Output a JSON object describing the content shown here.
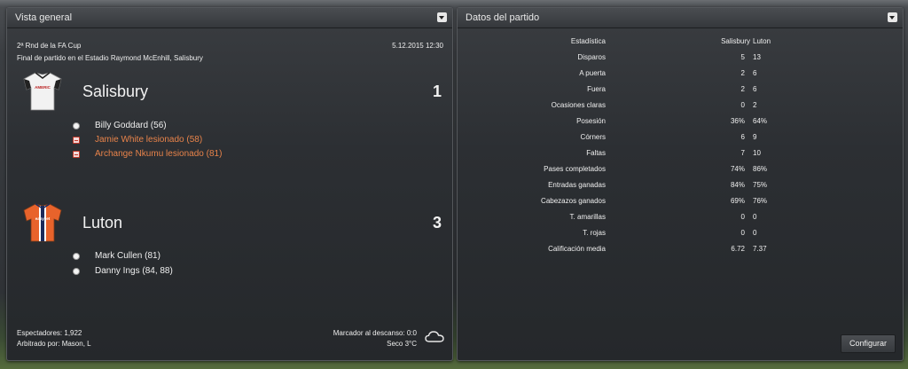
{
  "overview": {
    "title": "Vista general",
    "competition": "2ª Rnd de la FA Cup",
    "datetime": "5.12.2015 12:30",
    "venue": "Final de partido en el Estadio Raymond McEnhill, Salisbury",
    "home": {
      "name": "Salisbury",
      "score": "1",
      "shirt_text": "AMERIC",
      "events": [
        {
          "text": "Billy Goddard (56)",
          "type": "goal"
        },
        {
          "text": "Jamie White lesionado (58)",
          "type": "injury"
        },
        {
          "text": "Archange Nkumu lesionado (81)",
          "type": "injury"
        }
      ]
    },
    "away": {
      "name": "Luton",
      "score": "3",
      "shirt_text": "easyJet",
      "events": [
        {
          "text": "Mark Cullen (81)",
          "type": "goal"
        },
        {
          "text": "Danny Ings (84, 88)",
          "type": "goal"
        }
      ]
    },
    "attendance": "Espectadores: 1,922",
    "referee": "Arbitrado por: Mason, L",
    "halftime": "Marcador al descanso: 0:0",
    "weather": "Seco 3°C",
    "weather_icon": "cloud-icon"
  },
  "stats": {
    "title": "Datos del partido",
    "header": {
      "label": "Estadística",
      "home": "Salisbury",
      "away": "Luton"
    },
    "rows": [
      {
        "label": "Disparos",
        "home": "5",
        "away": "13"
      },
      {
        "label": "A puerta",
        "home": "2",
        "away": "6"
      },
      {
        "label": "Fuera",
        "home": "2",
        "away": "6"
      },
      {
        "label": "Ocasiones claras",
        "home": "0",
        "away": "2"
      },
      {
        "label": "Posesión",
        "home": "36%",
        "away": "64%"
      },
      {
        "label": "Córners",
        "home": "6",
        "away": "9"
      },
      {
        "label": "Faltas",
        "home": "7",
        "away": "10"
      },
      {
        "label": "Pases completados",
        "home": "74%",
        "away": "86%"
      },
      {
        "label": "Entradas ganadas",
        "home": "84%",
        "away": "75%"
      },
      {
        "label": "Cabezazos ganados",
        "home": "69%",
        "away": "76%"
      },
      {
        "label": "T. amarillas",
        "home": "0",
        "away": "0"
      },
      {
        "label": "T. rojas",
        "home": "0",
        "away": "0"
      },
      {
        "label": "Calificación media",
        "home": "6.72",
        "away": "7.37"
      }
    ],
    "configure_label": "Configurar"
  }
}
